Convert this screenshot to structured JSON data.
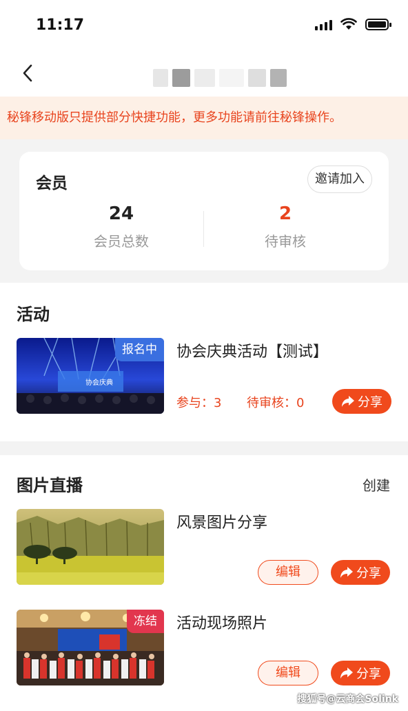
{
  "status_bar": {
    "time": "11:17"
  },
  "notice": "秘锋移动版只提供部分快捷功能，更多功能请前往秘锋操作。",
  "members": {
    "title": "会员",
    "invite_label": "邀请加入",
    "stats": [
      {
        "value": "24",
        "label": "会员总数",
        "color": "#222222"
      },
      {
        "value": "2",
        "label": "待审核",
        "color": "#e8441e"
      }
    ]
  },
  "activity": {
    "title": "活动",
    "item": {
      "badge": "报名中",
      "title": "协会庆典活动【测试】",
      "participants": "参与：3",
      "pending": "待审核：0",
      "share_label": "分享"
    }
  },
  "photo_live": {
    "title": "图片直播",
    "create_label": "创建",
    "items": [
      {
        "title": "风景图片分享",
        "edit_label": "编辑",
        "share_label": "分享"
      },
      {
        "badge": "冻结",
        "title": "活动现场照片",
        "edit_label": "编辑",
        "share_label": "分享"
      }
    ]
  },
  "watermark": "搜狐号@云商会Solink",
  "colors": {
    "accent": "#f04a1c",
    "badge_blue": "#3a6fe0",
    "badge_red": "#e2364e"
  }
}
